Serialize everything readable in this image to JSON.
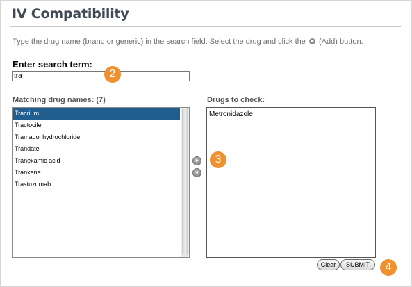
{
  "page": {
    "title": "IV Compatibility",
    "instructions_before": "Type the drug name (brand or generic) in the search field. Select the drug and click the",
    "instructions_after": "(Add) button."
  },
  "search": {
    "label": "Enter search term:",
    "value": "tra"
  },
  "matching": {
    "label": "Matching drug names: (7)",
    "items": [
      {
        "label": "Tracrium",
        "selected": true
      },
      {
        "label": "Tractocile",
        "selected": false
      },
      {
        "label": "Tramadol hydrochloride",
        "selected": false
      },
      {
        "label": "Trandate",
        "selected": false
      },
      {
        "label": "Tranexamic acid",
        "selected": false
      },
      {
        "label": "Tranxene",
        "selected": false
      },
      {
        "label": "Trastuzumab",
        "selected": false
      }
    ]
  },
  "check": {
    "label": "Drugs to check:",
    "items": [
      "Metronidazole"
    ]
  },
  "actions": {
    "add_icon": "arrow-right-circle-icon",
    "remove_icon": "arrow-left-circle-icon",
    "clear_label": "Clear",
    "submit_label": "SUBMIT"
  },
  "callouts": {
    "search_step": "2",
    "add_step": "3",
    "submit_step": "4"
  },
  "colors": {
    "selection": "#1f5e8f",
    "callout": "#f0902f",
    "title": "#3f4a55"
  }
}
